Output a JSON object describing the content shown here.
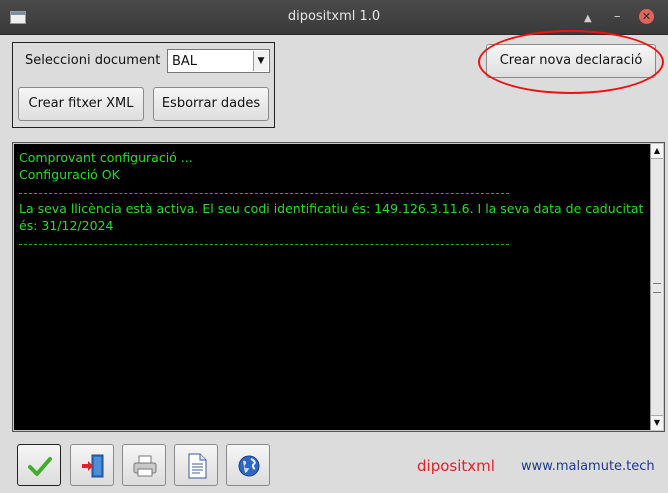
{
  "window": {
    "title": "dipositxml 1.0",
    "controls": [
      "up-icon",
      "minimize-icon",
      "close-icon"
    ]
  },
  "selector": {
    "label": "Seleccioni document",
    "value": "BAL"
  },
  "buttons": {
    "create_xml": "Crear fitxer XML",
    "erase": "Esborrar dades",
    "new_declaration": "Crear nova declaració"
  },
  "console": {
    "lines": [
      "Comprovant configuració ...",
      "Configuració OK",
      "La seva llicència està activa. El seu codi identificatiu és: 149.126.3.11.6.  I la seva data de caducitat és: 31/12/2024"
    ]
  },
  "toolbar": {
    "icons": [
      "check-icon",
      "exit-door-icon",
      "printer-icon",
      "document-icon",
      "globe-icon"
    ]
  },
  "footer": {
    "brand": "dipositxml",
    "website": "www.malamute.tech"
  },
  "colors": {
    "console_bg": "#000000",
    "console_text": "#2bdc2b",
    "brand": "#e3202a",
    "website": "#1c3a8c",
    "highlight_oval": "#e11111"
  }
}
